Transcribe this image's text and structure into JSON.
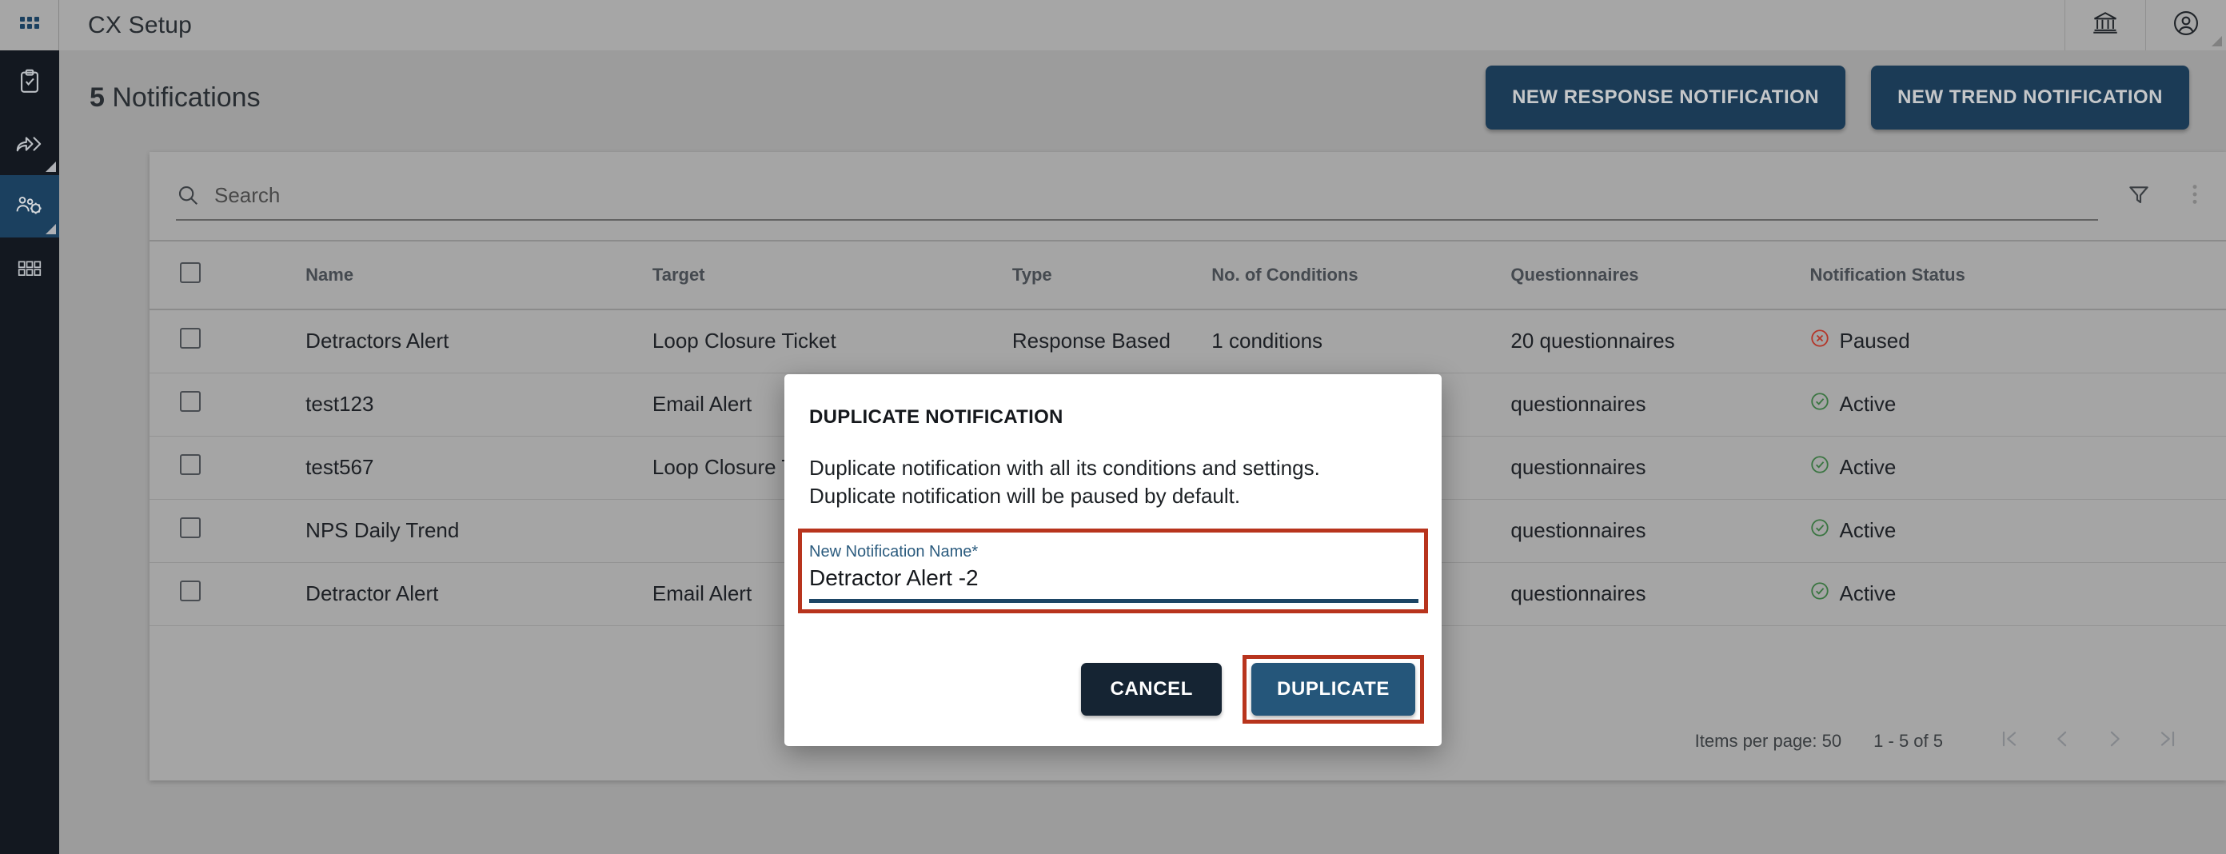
{
  "app": {
    "title": "CX Setup",
    "grid_icon": "apps-grid-icon",
    "bank_icon": "bank-institution-icon",
    "account_icon": "account-circle-icon"
  },
  "sidebar": {
    "items": [
      {
        "icon": "clipboard-check-icon",
        "active": false
      },
      {
        "icon": "share-forward-icon",
        "active": false
      },
      {
        "icon": "users-gear-icon",
        "active": true
      },
      {
        "icon": "grid-modules-icon",
        "active": false
      }
    ]
  },
  "page": {
    "count": "5",
    "title": "Notifications",
    "new_response_notification": "NEW RESPONSE NOTIFICATION",
    "new_trend_notification": "NEW TREND NOTIFICATION"
  },
  "search": {
    "placeholder": "Search",
    "value": "",
    "search_icon": "search-icon",
    "filter_icon": "funnel-filter-icon",
    "more_icon": "more-vertical-icon"
  },
  "table": {
    "headers": [
      "",
      "Name",
      "Target",
      "Type",
      "No. of Conditions",
      "Questionnaires",
      "Notification Status"
    ],
    "rows": [
      {
        "name": "Detractors Alert",
        "target": "Loop Closure Ticket",
        "type": "Response Based",
        "conditions": "1 conditions",
        "questionnaires": "20 questionnaires",
        "status": "Paused",
        "status_kind": "paused"
      },
      {
        "name": "test123",
        "target": "Email Alert",
        "type": "",
        "conditions": "",
        "questionnaires": "questionnaires",
        "status": "Active",
        "status_kind": "active"
      },
      {
        "name": "test567",
        "target": "Loop Closure Ticket",
        "type": "",
        "conditions": "",
        "questionnaires": "questionnaires",
        "status": "Active",
        "status_kind": "active"
      },
      {
        "name": "NPS Daily Trend",
        "target": "",
        "type": "",
        "conditions": "",
        "questionnaires": "questionnaires",
        "status": "Active",
        "status_kind": "active"
      },
      {
        "name": "Detractor Alert",
        "target": "Email Alert",
        "type": "",
        "conditions": "",
        "questionnaires": "questionnaires",
        "status": "Active",
        "status_kind": "active"
      }
    ]
  },
  "paginator": {
    "items_per_page_label": "Items per page:",
    "items_per_page_value": "50",
    "range": "1 - 5 of 5",
    "first_icon": "first-page-icon",
    "prev_icon": "previous-page-icon",
    "next_icon": "next-page-icon",
    "last_icon": "last-page-icon"
  },
  "modal": {
    "title": "DUPLICATE NOTIFICATION",
    "description": "Duplicate notification with all its conditions and settings. Duplicate notification will be paused by default.",
    "field_label": "New Notification Name*",
    "field_value": "Detractor Alert -2",
    "field_placeholder": "New Notification Name",
    "cancel_label": "CANCEL",
    "duplicate_label": "DUPLICATE"
  },
  "colors": {
    "accent_dark": "#1d3f5c",
    "accent_button": "#25567a",
    "cancel_dark": "#152433",
    "highlight_red": "#b8341d",
    "status_active_green": "#3e7d46",
    "status_paused_red": "#c0392b",
    "rail_dark": "#151a22",
    "rail_active": "#1d4565",
    "surface_grey": "#b0b0b0",
    "page_grey": "#a6a6a6"
  }
}
